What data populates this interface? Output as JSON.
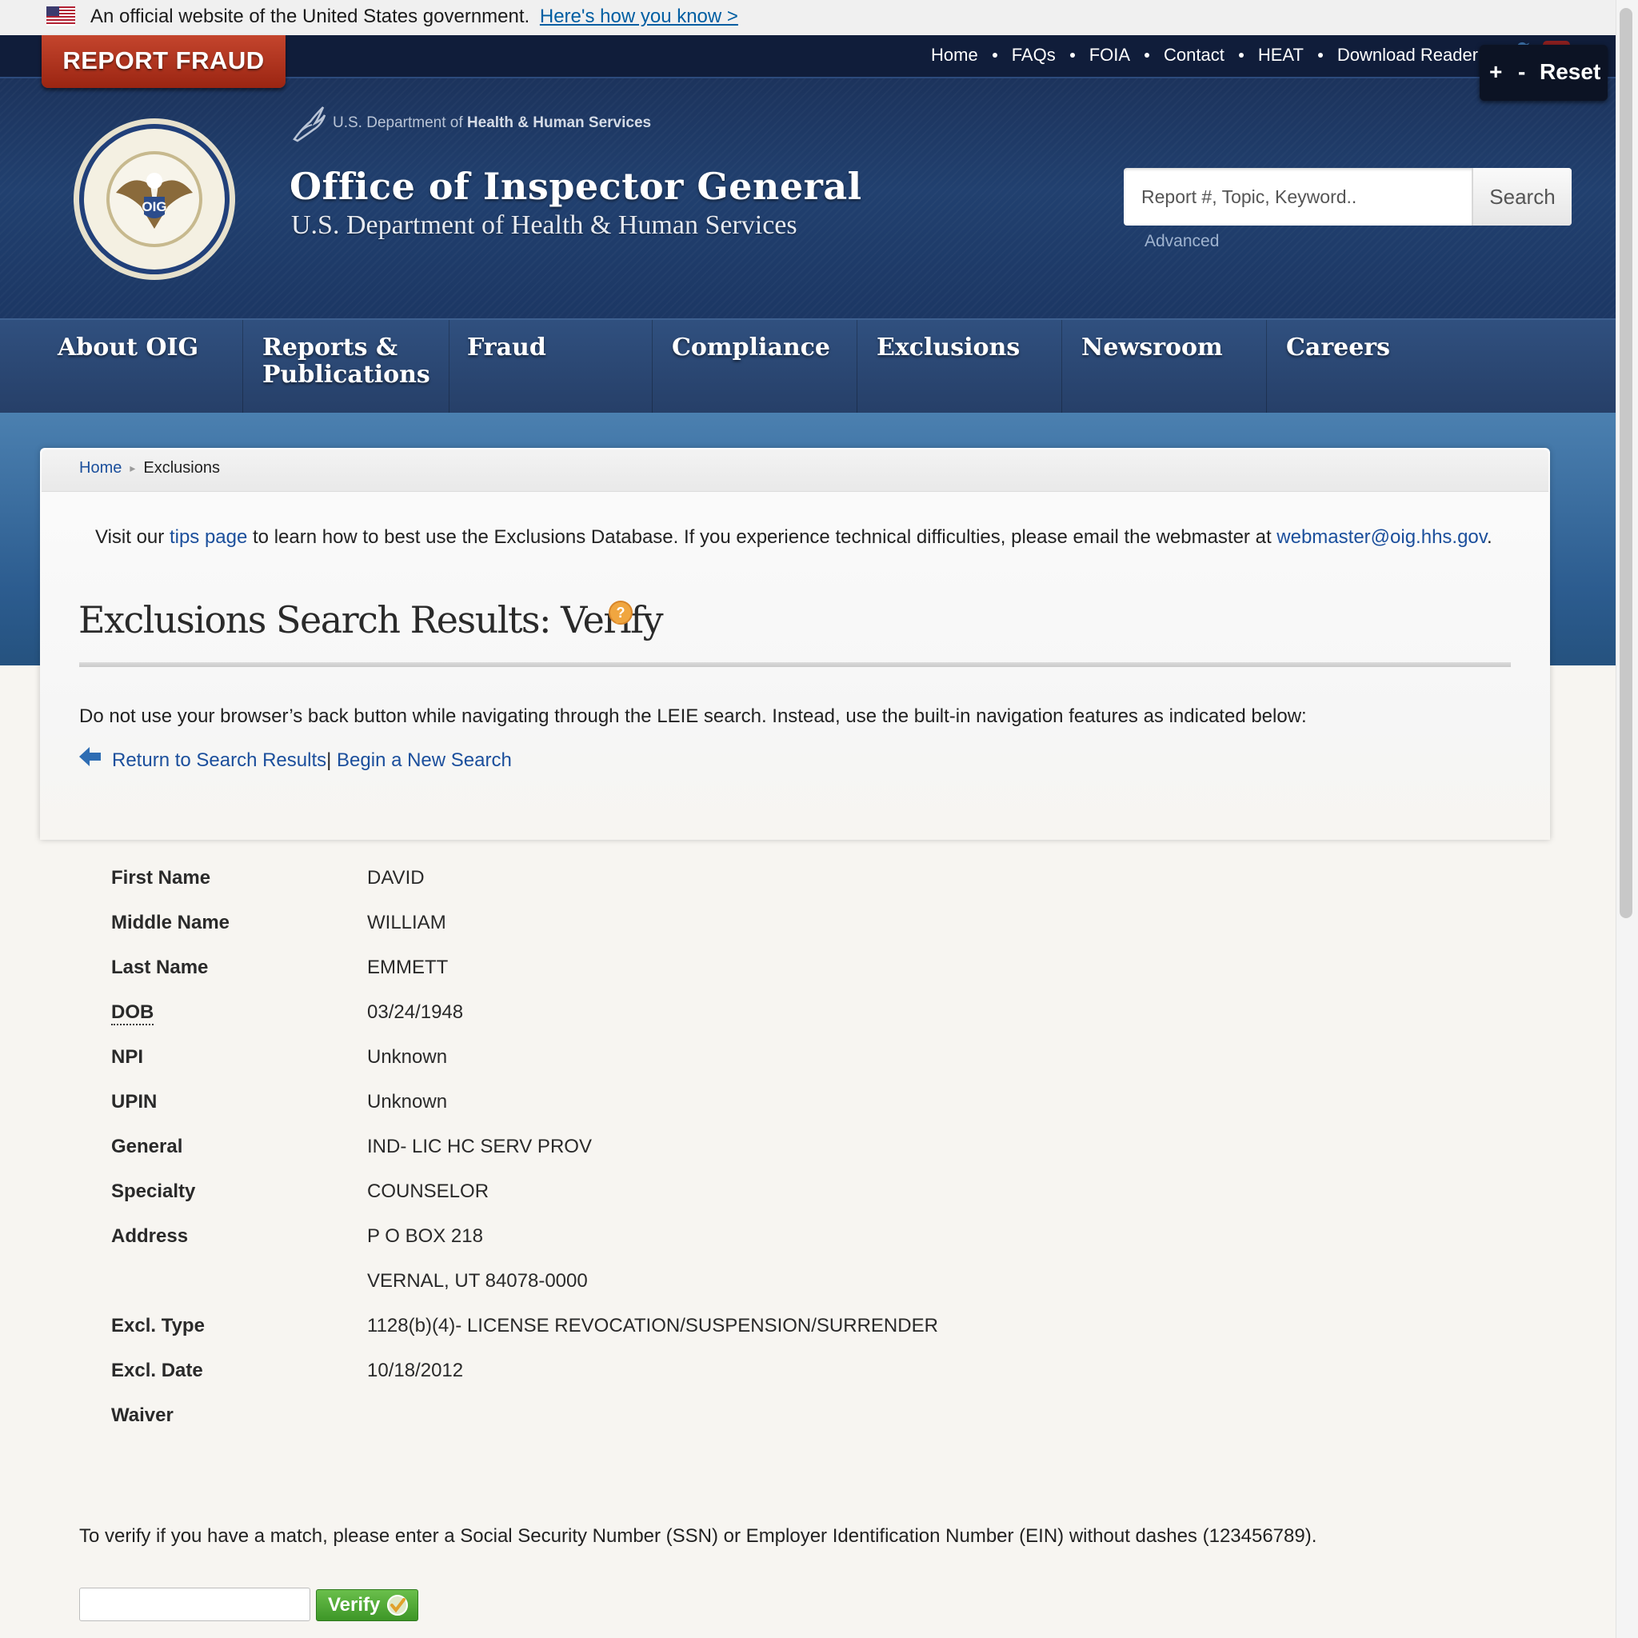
{
  "gov_banner": {
    "text": "An official website of the United States government.",
    "link": "Here's how you know >"
  },
  "header": {
    "report_fraud": "REPORT FRAUD",
    "top_nav": [
      "Home",
      "FAQs",
      "FOIA",
      "Contact",
      "HEAT",
      "Download Reader"
    ],
    "resizer": {
      "plus": "+",
      "minus": "-",
      "reset": "Reset"
    },
    "hhs_prefix": "U.S. Department of",
    "hhs_name": "Health & Human Services",
    "title": "Office of Inspector General",
    "subtitle": "U.S. Department of Health & Human Services",
    "seal_text_center": "OIG",
    "search": {
      "placeholder": "Report #, Topic, Keyword..",
      "button": "Search",
      "advanced": "Advanced"
    }
  },
  "main_nav": [
    "About OIG",
    "Reports & Publications",
    "Fraud",
    "Compliance",
    "Exclusions",
    "Newsroom",
    "Careers"
  ],
  "breadcrumb": {
    "home": "Home",
    "current": "Exclusions"
  },
  "tips": {
    "before": "Visit our ",
    "link": "tips page",
    "middle": " to learn how to best use the Exclusions Database. If you experience technical difficulties, please email the webmaster at ",
    "email": "webmaster@oig.hhs.gov",
    "after": "."
  },
  "page_title": "Exclusions Search Results: Verify",
  "nav_note": "Do not use your browser’s back button while navigating through the LEIE search. Instead, use the built-in navigation features as indicated below:",
  "nav_links": {
    "return": "Return to Search Results",
    "separator": "|",
    "new_search": "Begin a New Search"
  },
  "record": [
    {
      "label": "First Name",
      "value": "DAVID"
    },
    {
      "label": "Middle Name",
      "value": "WILLIAM"
    },
    {
      "label": "Last Name",
      "value": "EMMETT"
    },
    {
      "label": "DOB",
      "value": "03/24/1948"
    },
    {
      "label": "NPI",
      "value": "Unknown"
    },
    {
      "label": "UPIN",
      "value": "Unknown"
    },
    {
      "label": "General",
      "value": "IND- LIC HC SERV PROV"
    },
    {
      "label": "Specialty",
      "value": "COUNSELOR"
    },
    {
      "label": "Address",
      "value": "P O BOX 218"
    },
    {
      "label": "",
      "value": "VERNAL, UT 84078-0000"
    },
    {
      "label": "Excl. Type",
      "value": "1128(b)(4)- LICENSE REVOCATION/SUSPENSION/SURRENDER"
    },
    {
      "label": "Excl. Date",
      "value": "10/18/2012"
    },
    {
      "label": "Waiver",
      "value": ""
    }
  ],
  "verify": {
    "note": "To verify if you have a match, please enter a Social Security Number (SSN) or Employer Identification Number (EIN) without dashes (123456789).",
    "button": "Verify"
  }
}
